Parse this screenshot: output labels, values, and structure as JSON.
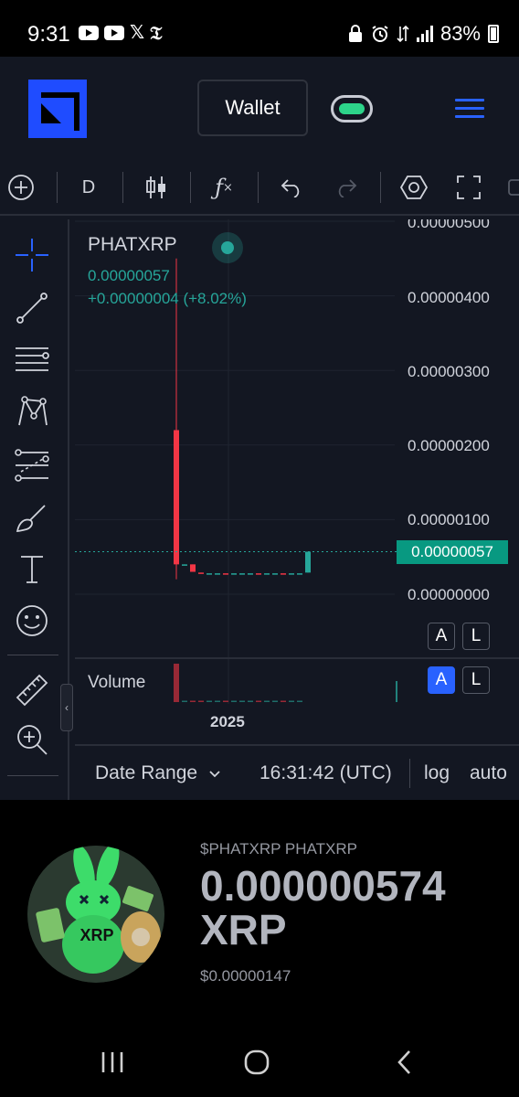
{
  "status_bar": {
    "time": "9:31",
    "battery": "83%",
    "icons": [
      "youtube-icon",
      "youtube-icon",
      "x-icon",
      "nyt-icon",
      "lock-icon",
      "alarm-icon",
      "data-icon",
      "signal-icon",
      "battery-icon"
    ]
  },
  "header": {
    "wallet_label": "Wallet"
  },
  "toolbar": {
    "interval": "D",
    "items": [
      "add-icon",
      "interval",
      "candles-icon",
      "indicators-icon",
      "undo-icon",
      "redo-icon",
      "settings-icon",
      "fullscreen-icon"
    ]
  },
  "drawing_tools": [
    "crosshair-icon",
    "trendline-icon",
    "fib-icon",
    "pattern-icon",
    "forecast-icon",
    "brush-icon",
    "text-icon",
    "emoji-icon",
    "ruler-icon",
    "zoom-in-icon"
  ],
  "chart": {
    "symbol": "PHATXRP",
    "last_value": "0.00000057",
    "change": "+0.00000004 (+8.02%)",
    "axis_labels": [
      "0.00000500",
      "0.00000400",
      "0.00000300",
      "0.00000200",
      "0.00000100",
      "0.00000000"
    ],
    "price_tag": "0.00000057",
    "auto_label": "A",
    "log_label": "L",
    "volume_label": "Volume",
    "year_label": "2025"
  },
  "chart_data": {
    "type": "candlestick",
    "title": "PHATXRP",
    "ylim": [
      0,
      5e-06
    ],
    "log_scale": false,
    "candles": [
      {
        "open": 2.2e-06,
        "high": 4.5e-06,
        "low": 2e-07,
        "close": 4e-07,
        "dir": "down"
      },
      {
        "open": 4e-07,
        "high": 4e-07,
        "low": 3.9e-07,
        "close": 3.9e-07,
        "dir": "up"
      },
      {
        "open": 4e-07,
        "high": 4e-07,
        "low": 3e-07,
        "close": 3e-07,
        "dir": "down"
      },
      {
        "open": 2.9e-07,
        "high": 2.9e-07,
        "low": 2.8e-07,
        "close": 2.8e-07,
        "dir": "down"
      },
      {
        "open": 2.8e-07,
        "high": 2.8e-07,
        "low": 2.8e-07,
        "close": 2.8e-07,
        "dir": "up"
      },
      {
        "open": 2.8e-07,
        "high": 2.8e-07,
        "low": 2.8e-07,
        "close": 2.8e-07,
        "dir": "up"
      },
      {
        "open": 2.8e-07,
        "high": 2.8e-07,
        "low": 2.8e-07,
        "close": 2.8e-07,
        "dir": "down"
      },
      {
        "open": 2.8e-07,
        "high": 2.8e-07,
        "low": 2.8e-07,
        "close": 2.8e-07,
        "dir": "up"
      },
      {
        "open": 2.8e-07,
        "high": 2.8e-07,
        "low": 2.8e-07,
        "close": 2.8e-07,
        "dir": "up"
      },
      {
        "open": 2.8e-07,
        "high": 2.8e-07,
        "low": 2.8e-07,
        "close": 2.8e-07,
        "dir": "up"
      },
      {
        "open": 2.8e-07,
        "high": 2.8e-07,
        "low": 2.8e-07,
        "close": 2.8e-07,
        "dir": "down"
      },
      {
        "open": 2.8e-07,
        "high": 2.8e-07,
        "low": 2.8e-07,
        "close": 2.8e-07,
        "dir": "up"
      },
      {
        "open": 2.8e-07,
        "high": 2.8e-07,
        "low": 2.8e-07,
        "close": 2.8e-07,
        "dir": "up"
      },
      {
        "open": 2.8e-07,
        "high": 2.8e-07,
        "low": 2.8e-07,
        "close": 2.8e-07,
        "dir": "down"
      },
      {
        "open": 2.8e-07,
        "high": 2.8e-07,
        "low": 2.8e-07,
        "close": 2.8e-07,
        "dir": "up"
      },
      {
        "open": 2.8e-07,
        "high": 2.8e-07,
        "low": 2.8e-07,
        "close": 2.8e-07,
        "dir": "up"
      },
      {
        "open": 2.9e-07,
        "high": 5.7e-07,
        "low": 2.9e-07,
        "close": 5.7e-07,
        "dir": "up"
      }
    ],
    "last_price": 5.7e-07,
    "colors": {
      "up": "#26a69a",
      "down": "#f23645",
      "bg": "#131722",
      "grid": "#1f2430"
    }
  },
  "bottom_bar": {
    "date_range": "Date Range",
    "time": "16:31:42 (UTC)",
    "log": "log",
    "auto": "auto"
  },
  "token": {
    "ticker": "$PHATXRP PHATXRP",
    "price_line1": "0.000000574",
    "price_line2": "XRP",
    "usd": "$0.00000147",
    "avatar_text": "XRP"
  },
  "nav": [
    "recents-icon",
    "home-icon",
    "back-icon"
  ]
}
